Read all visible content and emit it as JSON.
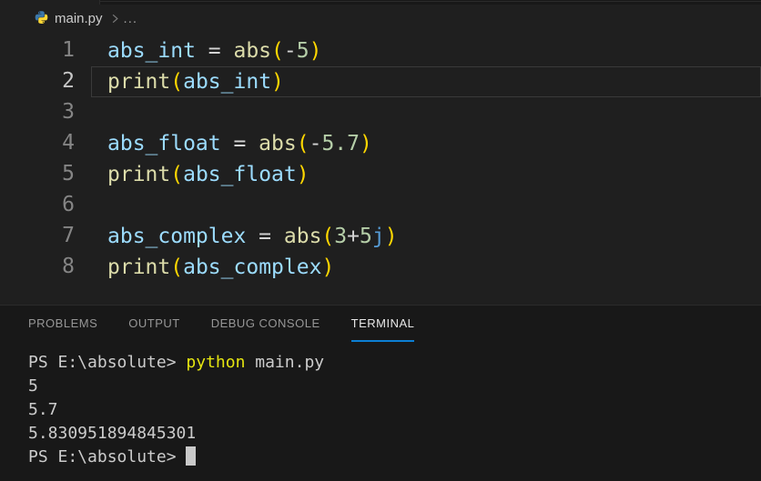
{
  "breadcrumb": {
    "file_name": "main.py",
    "ellipsis": "...",
    "file_icon": "python-icon"
  },
  "colors": {
    "editor_background": "#1f1f1f",
    "panel_background": "#181818",
    "border": "#2b2b2b",
    "accent_tab_underline": "#0c7fd4",
    "token_variable": "#9cdcfe",
    "token_function": "#dcdcaa",
    "token_bracket": "#ffd700",
    "token_number": "#b5cea8",
    "token_imaginary_suffix": "#569cd6",
    "token_operator": "#d4d4d4",
    "terminal_foreground": "#cccccc",
    "terminal_command": "#e5e510",
    "line_number": "#858585",
    "line_number_active": "#c6c6c6"
  },
  "editor": {
    "active_line": 2,
    "lines": [
      {
        "n": "1",
        "tokens": [
          [
            "var",
            "abs_int"
          ],
          [
            "op",
            " = "
          ],
          [
            "fn",
            "abs"
          ],
          [
            "paren",
            "("
          ],
          [
            "op",
            "-"
          ],
          [
            "num",
            "5"
          ],
          [
            "paren",
            ")"
          ]
        ]
      },
      {
        "n": "2",
        "tokens": [
          [
            "fn",
            "print"
          ],
          [
            "paren",
            "("
          ],
          [
            "var",
            "abs_int"
          ],
          [
            "paren",
            ")"
          ]
        ]
      },
      {
        "n": "3",
        "tokens": []
      },
      {
        "n": "4",
        "tokens": [
          [
            "var",
            "abs_float"
          ],
          [
            "op",
            " = "
          ],
          [
            "fn",
            "abs"
          ],
          [
            "paren",
            "("
          ],
          [
            "op",
            "-"
          ],
          [
            "num",
            "5.7"
          ],
          [
            "paren",
            ")"
          ]
        ]
      },
      {
        "n": "5",
        "tokens": [
          [
            "fn",
            "print"
          ],
          [
            "paren",
            "("
          ],
          [
            "var",
            "abs_float"
          ],
          [
            "paren",
            ")"
          ]
        ]
      },
      {
        "n": "6",
        "tokens": []
      },
      {
        "n": "7",
        "tokens": [
          [
            "var",
            "abs_complex"
          ],
          [
            "op",
            " = "
          ],
          [
            "fn",
            "abs"
          ],
          [
            "paren",
            "("
          ],
          [
            "num",
            "3"
          ],
          [
            "op",
            "+"
          ],
          [
            "num",
            "5"
          ],
          [
            "imag",
            "j"
          ],
          [
            "paren",
            ")"
          ]
        ]
      },
      {
        "n": "8",
        "tokens": [
          [
            "fn",
            "print"
          ],
          [
            "paren",
            "("
          ],
          [
            "var",
            "abs_complex"
          ],
          [
            "paren",
            ")"
          ]
        ]
      }
    ]
  },
  "panel": {
    "tabs": [
      {
        "label": "PROBLEMS",
        "active": false
      },
      {
        "label": "OUTPUT",
        "active": false
      },
      {
        "label": "DEBUG CONSOLE",
        "active": false
      },
      {
        "label": "TERMINAL",
        "active": true
      }
    ]
  },
  "terminal": {
    "lines": [
      {
        "tokens": [
          [
            "plain",
            "PS E:\\absolute> "
          ],
          [
            "cmd",
            "python"
          ],
          [
            "plain",
            " main.py"
          ]
        ],
        "cursor": false
      },
      {
        "tokens": [
          [
            "plain",
            "5"
          ]
        ],
        "cursor": false
      },
      {
        "tokens": [
          [
            "plain",
            "5.7"
          ]
        ],
        "cursor": false
      },
      {
        "tokens": [
          [
            "plain",
            "5.830951894845301"
          ]
        ],
        "cursor": false
      },
      {
        "tokens": [
          [
            "plain",
            "PS E:\\absolute> "
          ]
        ],
        "cursor": true
      }
    ]
  }
}
